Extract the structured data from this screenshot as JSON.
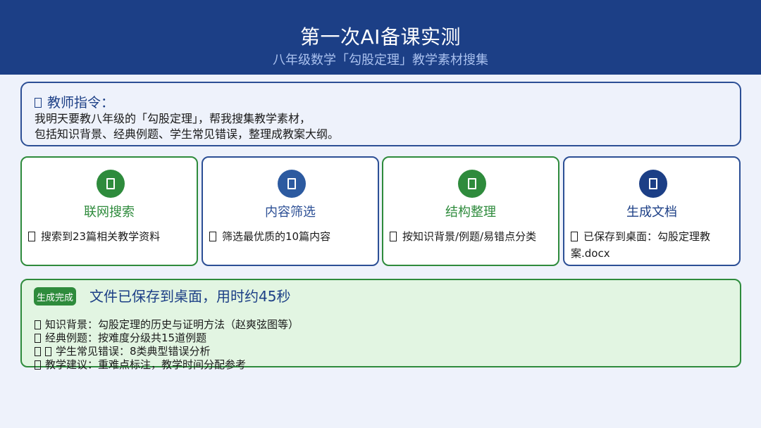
{
  "header": {
    "title": "第一次AI备课实测",
    "subtitle": "八年级数学「勾股定理」教学素材搜集"
  },
  "instruction": {
    "title": "教师指令：",
    "line1": "我明天要教八年级的「勾股定理」，帮我搜集教学素材，",
    "line2": "包括知识背景、经典例题、学生常见错误，整理成教案大纲。"
  },
  "steps": [
    {
      "icon": "search-icon",
      "color": "#2e8b3c",
      "label": "联网搜索",
      "desc": "搜索到23篇相关教学资料"
    },
    {
      "icon": "filter-icon",
      "color": "#2c5aa0",
      "label": "内容筛选",
      "desc": "筛选最优质的10篇内容"
    },
    {
      "icon": "structure-icon",
      "color": "#2e8b3c",
      "label": "结构整理",
      "desc": "按知识背景/例题/易错点分类"
    },
    {
      "icon": "document-icon",
      "color": "#1c3f86",
      "label": "生成文档",
      "desc": "已保存到桌面：勾股定理教案.docx"
    }
  ],
  "result": {
    "badge": "生成完成",
    "message": "文件已保存到桌面，用时约45秒",
    "items": [
      "知识背景：勾股定理的历史与证明方法（赵爽弦图等）",
      "经典例题：按难度分级共15道例题",
      " 学生常见错误：8类典型错误分析",
      "教学建议：重难点标注，教学时间分配参考"
    ]
  },
  "colors": {
    "header_bg": "#1c3f86",
    "accent_green": "#2e8b3c",
    "accent_blue": "#2c4f95",
    "result_bg": "#e2f5e2"
  }
}
